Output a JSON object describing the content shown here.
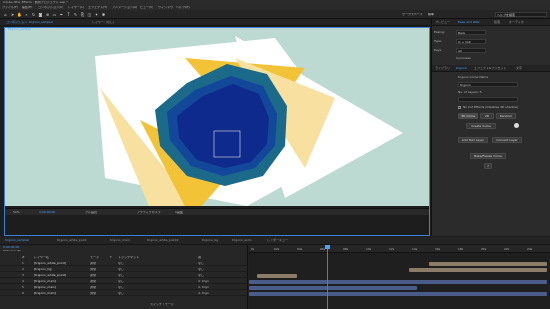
{
  "app": {
    "title": "Adobe After Effects - 無題プロジェクト.aep *",
    "menus": [
      "ファイル(F)",
      "編集(E)",
      "コンポジション(C)",
      "レイヤー(L)",
      "エフェクト(T)",
      "アニメーション(A)",
      "ビュー(V)",
      "ウィンドウ",
      "ヘルプ(H)"
    ],
    "workspace": {
      "label": "ワークスペース",
      "value": "標準",
      "search_placeholder": "ヘルプを検索"
    }
  },
  "viewer": {
    "tabs": [
      "コンポジション: trigono_samplel",
      "レイヤー: (なし)"
    ],
    "breadcrumbs": [
      "trigono_sample",
      "trigono_anim"
    ],
    "footer": {
      "zoom": "50%",
      "timecode": "0;00;00;00",
      "resolution": "フル画質",
      "camera": "アクティブカメラ",
      "views": "1画面"
    }
  },
  "right_panel": {
    "tabs": [
      "プレビュー",
      "Ease and Wizz",
      "段落",
      "オーディオ"
    ],
    "easing": {
      "label": "Easing:",
      "value": "Back"
    },
    "type": {
      "label": "Type:",
      "value": "In + Out"
    },
    "keys": {
      "label": "Keys:",
      "value": "All"
    },
    "curviness_label": "Curviness",
    "tabs2": [
      "ライブラリ",
      "trigono",
      "エフェクト&プリセット",
      "文字"
    ],
    "plugin_title": "trigono Come Name",
    "name_value": "trigono",
    "no_layers_label": "No. of Layers: 5",
    "checkbox_label": "No Cut Effects (Disables 3D shadow)",
    "btn_3d": "3D Come",
    "btn_2d": "2D",
    "btn_random": "Random",
    "btn_create": "Create Come",
    "btn_add_text": "Add Text Layer",
    "btn_convert": "Convert Layer",
    "btn_bake": "Bake/Freeze Come",
    "help": "?"
  },
  "timeline": {
    "tabs": [
      "trigono_samplel",
      "trigono_white_point",
      "trigono_main",
      "trigono_white_point2",
      "trigono_bg",
      "trigono_anim",
      "レンダーキュー"
    ],
    "timecode": "0;00;00;00",
    "fps": "00000 (29.97 fps)",
    "columns": [
      "#",
      "レイヤー名",
      "モード",
      "T",
      "トラックマット",
      "親"
    ],
    "layers": [
      {
        "num": "1",
        "name": "[trigono_white_point]",
        "mode": "通常",
        "matte": "なし",
        "parent": "なし"
      },
      {
        "num": "2",
        "name": "[trigono_bg]",
        "mode": "通常",
        "matte": "なし",
        "parent": "なし"
      },
      {
        "num": "3",
        "name": "[trigono_white_point]",
        "mode": "通常",
        "matte": "なし",
        "parent": "なし"
      },
      {
        "num": "4",
        "name": "[trigono_main]",
        "mode": "通常",
        "matte": "なし",
        "parent": "4. trigo"
      },
      {
        "num": "5",
        "name": "[trigono_main]",
        "mode": "通常",
        "matte": "なし",
        "parent": "4. trigo"
      },
      {
        "num": "6",
        "name": "[trigono_main]",
        "mode": "通常",
        "matte": "なし",
        "parent": "4. trigo"
      }
    ],
    "ruler": [
      "0s",
      "02s",
      "04s",
      "06s",
      "08s",
      "10s",
      "12s",
      "14s",
      "16s",
      "18s",
      "20s",
      "22s",
      "24s"
    ],
    "footer": "スイッチ / モード"
  },
  "colors": {
    "accent": "#3b82d6",
    "comp_bg": "#bcd9d2",
    "yellow": "#f2c336",
    "pale_yellow": "#f7e0a0",
    "navy": "#0d2a8c",
    "teal": "#1b6a8a",
    "playhead": "#e24a4a"
  }
}
